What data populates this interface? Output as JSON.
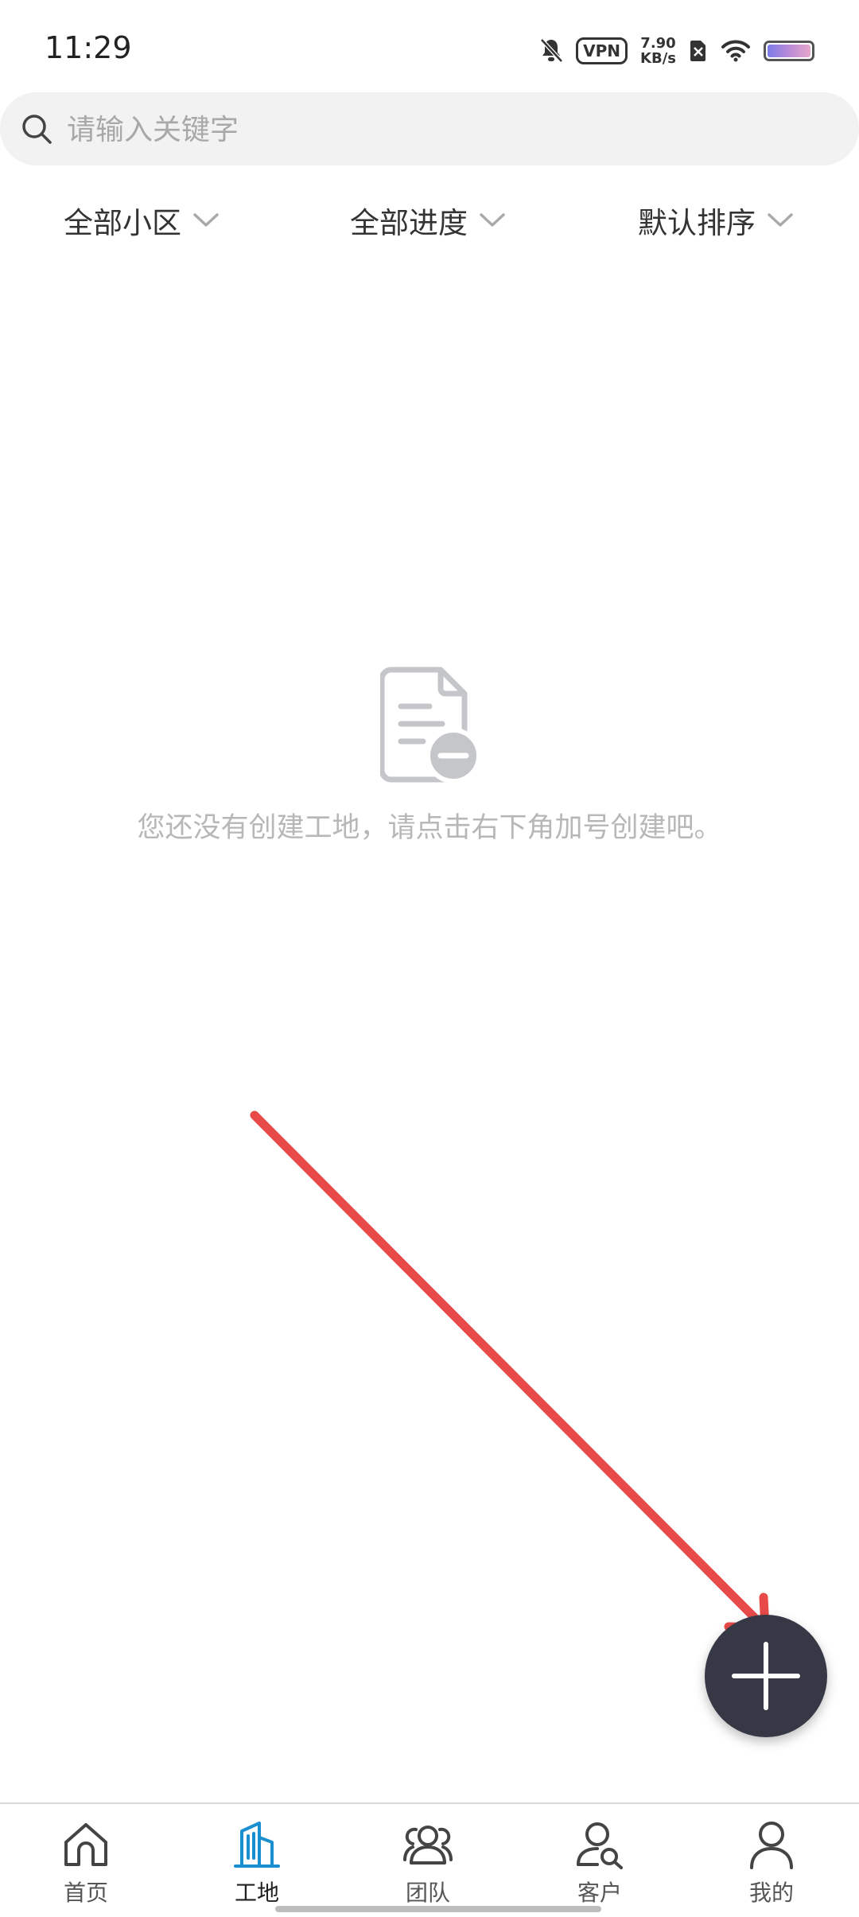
{
  "status_bar": {
    "time": "11:29",
    "vpn": "VPN",
    "net_speed_value": "7.90",
    "net_speed_unit": "KB/s",
    "icons": [
      "bell-off-icon",
      "vpn-badge",
      "no-sim-icon",
      "wifi-icon",
      "battery-icon"
    ]
  },
  "search": {
    "placeholder": "请输入关键字",
    "value": ""
  },
  "filters": [
    {
      "label": "全部小区"
    },
    {
      "label": "全部进度"
    },
    {
      "label": "默认排序"
    }
  ],
  "empty_state": {
    "icon": "document-minus-icon",
    "message": "您还没有创建工地，请点击右下角加号创建吧。"
  },
  "fab": {
    "icon": "plus-icon"
  },
  "bottom_nav": {
    "active_index": 1,
    "items": [
      {
        "label": "首页",
        "icon": "home-icon"
      },
      {
        "label": "工地",
        "icon": "building-icon"
      },
      {
        "label": "团队",
        "icon": "team-icon"
      },
      {
        "label": "客户",
        "icon": "customer-search-icon"
      },
      {
        "label": "我的",
        "icon": "profile-icon"
      }
    ]
  },
  "colors": {
    "accent": "#1a8fd0",
    "fab": "#363945",
    "annotation_arrow": "#e84a4a",
    "muted_text": "#b7b7b7"
  }
}
